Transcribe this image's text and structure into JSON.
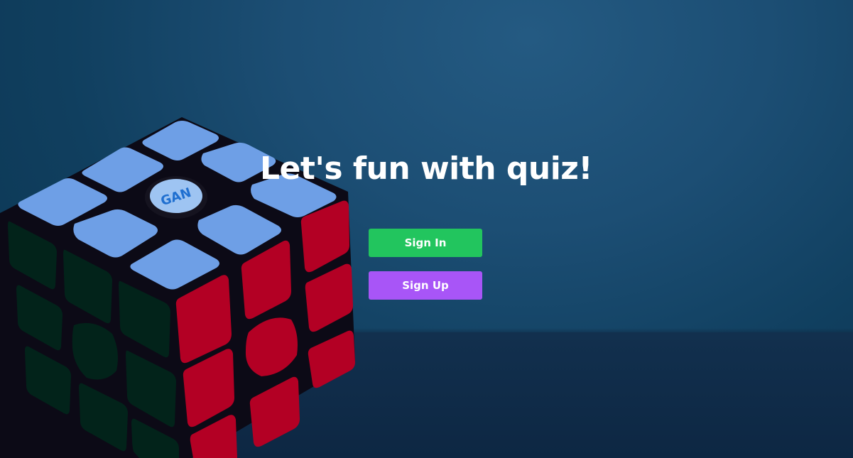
{
  "hero": {
    "title": "Let's fun with quiz!",
    "signin_label": "Sign In",
    "signup_label": "Sign Up"
  },
  "cube_logo_text": "GAN",
  "colors": {
    "signin": "#22c55e",
    "signup": "#a855f7",
    "background": "#1c4e74",
    "cube_blue": "#6e9fe6",
    "cube_red": "#b30024",
    "cube_green": "#02231a"
  }
}
